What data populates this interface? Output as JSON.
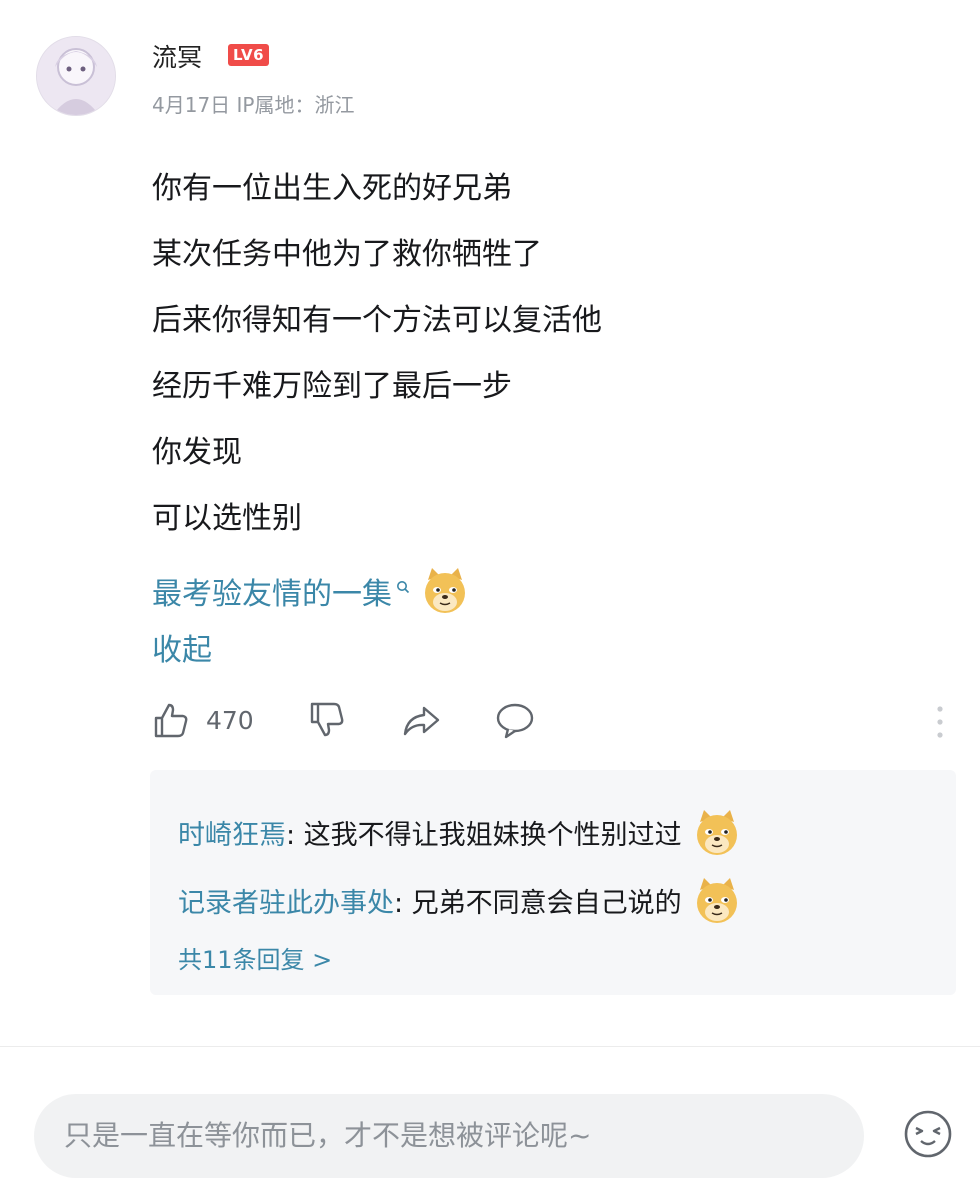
{
  "comment": {
    "username": "流冥",
    "level_badge": "LV6",
    "meta": "4月17日 IP属地：浙江",
    "lines": [
      "你有一位出生入死的好兄弟",
      "某次任务中他为了救你牺牲了",
      "后来你得知有一个方法可以复活他",
      "经历千难万险到了最后一步",
      "你发现",
      "可以选性别"
    ],
    "link_line": "最考验友情的一集",
    "collapse_label": "收起"
  },
  "actions": {
    "like_count": "470",
    "icons": [
      "thumb-up-icon",
      "thumb-down-icon",
      "share-icon",
      "comment-icon",
      "more-icon"
    ]
  },
  "replies": {
    "items": [
      {
        "author": "时崎狂焉",
        "text": ": 这我不得让我姐妹换个性别过过"
      },
      {
        "author": "记录者驻此办事处",
        "text": ": 兄弟不同意会自己说的"
      }
    ],
    "count_label": "共11条回复 >"
  },
  "input": {
    "placeholder": "只是一直在等你而已，才不是想被评论呢~"
  },
  "colors": {
    "link": "#3b87a8",
    "badge": "#f04c49",
    "reply_bg": "#f6f7f9"
  }
}
